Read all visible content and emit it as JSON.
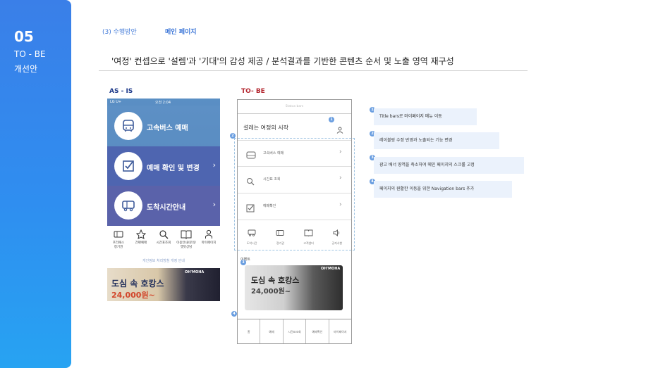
{
  "sidebar": {
    "number": "05",
    "line1": "TO - BE",
    "line2": "개선안"
  },
  "breadcrumb": {
    "section": "(3) 수행방안",
    "page": "메인 페이지"
  },
  "headline": "'여정' 컨셉으로 '설렘'과 '기대'의 감성 제공 / 분석결과를 기반한 콘텐츠 순서 및 노출 영역 재구성",
  "asis": {
    "label": "AS - IS",
    "status": {
      "carrier": "LG U+",
      "time": "오전 2:04"
    },
    "menu": [
      {
        "label": "고속버스 예매",
        "icon": "bus-icon"
      },
      {
        "label": "예매 확인 및 변경",
        "icon": "checkbox-icon"
      },
      {
        "label": "도착시간안내",
        "icon": "bus-arrival-icon"
      }
    ],
    "quick_icons": [
      {
        "label": "프리패스\n정기권",
        "icon": "ticket-icon"
      },
      {
        "label": "간편예매",
        "icon": "star-icon"
      },
      {
        "label": "시간표조회",
        "icon": "search-icon"
      },
      {
        "label": "이용안내/문의/\n챗봇상담",
        "icon": "book-icon"
      },
      {
        "label": "마이페이지",
        "icon": "person-icon"
      }
    ],
    "notice": "개인정보 처리방침 개정 안내",
    "banner": {
      "title": "도심 속 호캉스",
      "price": "24,000원~",
      "logo": "OH'MOHA"
    }
  },
  "tobe": {
    "label": "TO- BE",
    "status_bar": "Status bars",
    "title": "설레는 여정의 시작",
    "menu": [
      {
        "label": "고속버스 예매",
        "icon": "bus-icon"
      },
      {
        "label": "시간표 조회",
        "icon": "search-icon"
      },
      {
        "label": "예매확인",
        "icon": "checkbox-icon"
      }
    ],
    "quick": [
      {
        "label": "도착시간",
        "icon": "bus-arrival-icon"
      },
      {
        "label": "정기권",
        "icon": "ticket-icon"
      },
      {
        "label": "고객센터",
        "icon": "book-icon"
      },
      {
        "label": "공지사항",
        "icon": "speaker-icon"
      }
    ],
    "event_label": "이벤트",
    "banner": {
      "title": "도심 속 호캉스",
      "price": "24,000원~",
      "logo": "OH'MOHA"
    },
    "tabs": [
      "홈",
      "예매",
      "시간표조회",
      "예매확인",
      "마이페이지"
    ],
    "badges": [
      "1",
      "2",
      "3",
      "4"
    ]
  },
  "notes": [
    {
      "num": "1",
      "text": "Title bars로 마이페이지 메뉴 이동"
    },
    {
      "num": "2",
      "text": "레이블링 수정 반영과 노출되는 기능 변경"
    },
    {
      "num": "3",
      "text": "광고 배너 영역을 축소하여 메인 페이지의 스크롤 고정"
    },
    {
      "num": "4",
      "text": "페이지의 원활한 이동을 위한 Navigation bars 추가"
    }
  ],
  "colors": {
    "sidebar": "#2f8ef0",
    "asis_label": "#1e3a8a",
    "tobe_label": "#b3262f",
    "badge": "#6a9ee0",
    "note_bg": "#ebf2fc"
  }
}
